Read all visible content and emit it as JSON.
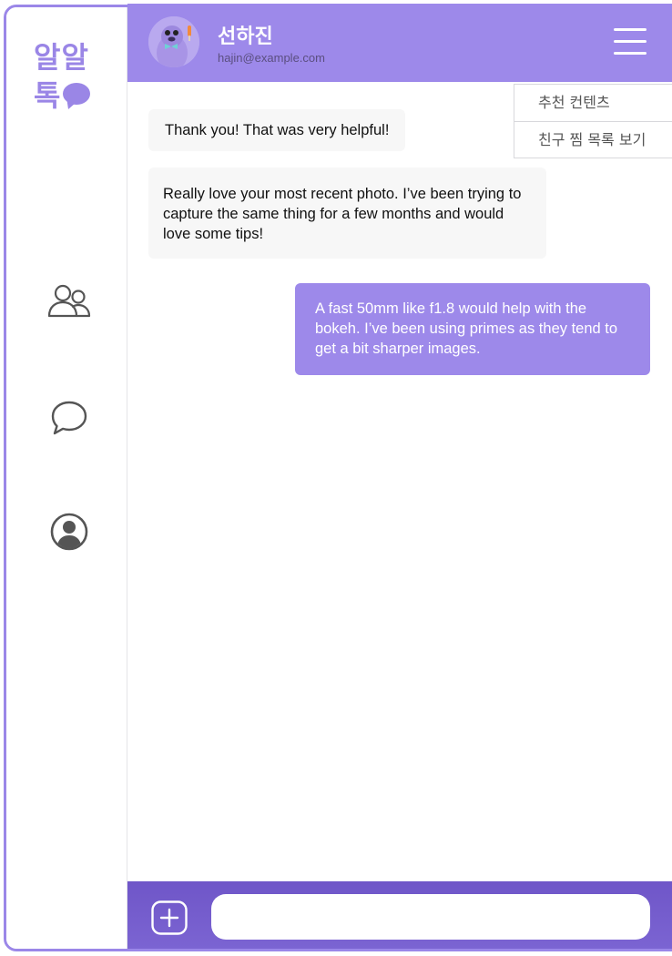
{
  "app": {
    "logo_line1": "알알",
    "logo_line2": "톡",
    "accent_color": "#9d89ea"
  },
  "sidebar": {
    "items": [
      {
        "icon": "friends-icon"
      },
      {
        "icon": "chat-bubble-icon"
      },
      {
        "icon": "profile-icon"
      }
    ]
  },
  "header": {
    "name": "선하진",
    "email": "hajin@example.com",
    "menu_icon": "hamburger-menu-icon"
  },
  "dropdown": {
    "items": [
      "추천 컨텐츠",
      "친구 찜 목록 보기"
    ]
  },
  "messages": [
    {
      "direction": "incoming",
      "text": "Thank you! That was very helpful!"
    },
    {
      "direction": "incoming",
      "text": "Really love your most recent photo. I’ve been trying to capture the same thing for a few months and would love some tips!"
    },
    {
      "direction": "outgoing",
      "text": "A fast 50mm like f1.8 would help with the bokeh. I’ve been using primes as they tend to get a bit sharper images."
    }
  ],
  "composer": {
    "add_icon": "plus-icon",
    "input_value": "",
    "input_placeholder": ""
  }
}
